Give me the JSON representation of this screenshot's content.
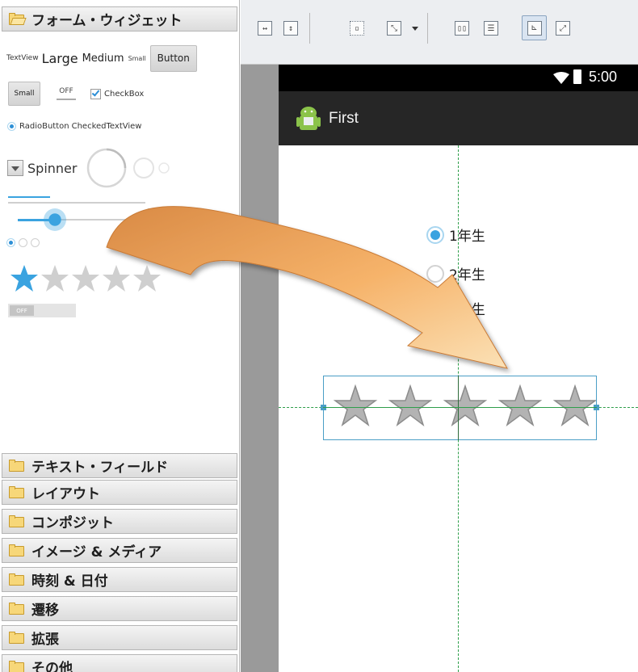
{
  "palette": {
    "forms": {
      "header": "フォーム・ウィジェット",
      "textview": "TextView",
      "large": "Large",
      "medium": "Medium",
      "small": "Small",
      "button": "Button",
      "small_button": "Small",
      "toggle_off": "OFF",
      "checkbox": "CheckBox",
      "radiobutton": "RadioButton",
      "checkedtextview": "CheckedTextView",
      "spinner": "Spinner",
      "switch_off": "OFF"
    },
    "categories": [
      {
        "label": "テキスト・フィールド"
      },
      {
        "label": "レイアウト"
      },
      {
        "label": "コンポジット"
      },
      {
        "label": "イメージ & メディア"
      },
      {
        "label": "時刻 & 日付"
      },
      {
        "label": "遷移"
      },
      {
        "label": "拡張"
      },
      {
        "label": "その他"
      }
    ]
  },
  "toolbar": {
    "icons": [
      "fill-width-icon",
      "fill-height-icon",
      "margins-icon",
      "gravity-icon",
      "dropdown-arrow-icon",
      "layout-width-icon",
      "layout-height-icon",
      "baseline-icon",
      "distribute-icon"
    ],
    "active_index": 7
  },
  "device": {
    "status_time": "5:00",
    "app_title": "First",
    "radios": [
      {
        "label": "1年生",
        "checked": true
      },
      {
        "label": "2年生",
        "checked": false
      },
      {
        "label": "3年生",
        "checked": false
      }
    ],
    "rating": {
      "stars": 5,
      "filled": 0
    }
  },
  "colors": {
    "accent_blue": "#3aa3e0",
    "arrow_orange": "#f0a050",
    "guide_green": "#2e9e4a",
    "selection": "#4a9ec6"
  }
}
